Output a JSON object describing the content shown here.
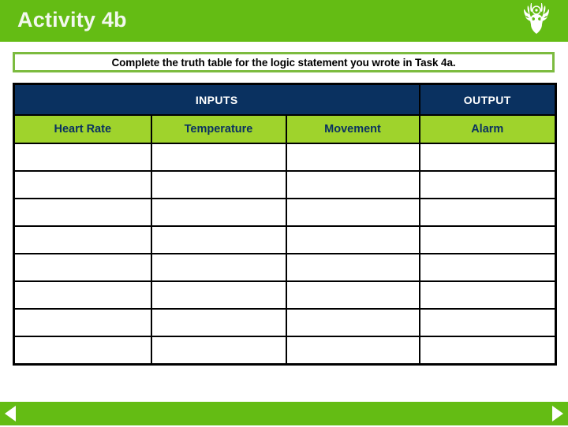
{
  "header": {
    "title": "Activity 4b",
    "logo_icon": "stag-head-logo-icon",
    "background_color": "#64bc14",
    "title_color": "#f2f7ee"
  },
  "instruction": {
    "text": "Complete the truth table for the logic statement you wrote in Task 4a.",
    "border_color": "#7cbb3f"
  },
  "table": {
    "group_headers": [
      {
        "label": "INPUTS",
        "span": 3
      },
      {
        "label": "OUTPUT",
        "span": 1
      }
    ],
    "columns": [
      "Heart Rate",
      "Temperature",
      "Movement",
      "Alarm"
    ],
    "rows": [
      [
        "",
        "",
        "",
        ""
      ],
      [
        "",
        "",
        "",
        ""
      ],
      [
        "",
        "",
        "",
        ""
      ],
      [
        "",
        "",
        "",
        ""
      ],
      [
        "",
        "",
        "",
        ""
      ],
      [
        "",
        "",
        "",
        ""
      ],
      [
        "",
        "",
        "",
        ""
      ],
      [
        "",
        "",
        "",
        ""
      ]
    ],
    "group_header_bg": "#0a3160",
    "group_header_color": "#ffffff",
    "column_header_bg": "#9fd32c",
    "column_header_color": "#0a3160",
    "border_color": "#000000"
  },
  "navigation": {
    "background_color": "#64bc14",
    "previous_icon": "triangle-left-icon",
    "next_icon": "triangle-right-icon",
    "previous_label": "Previous slide",
    "next_label": "Next slide"
  }
}
